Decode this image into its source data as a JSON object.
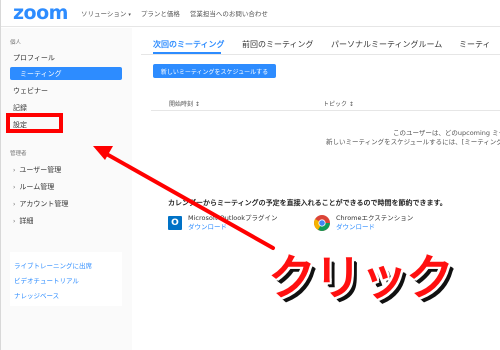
{
  "header": {
    "logo": "zoom",
    "nav": [
      {
        "label": "ソリューション",
        "chevron": "▾"
      },
      {
        "label": "プランと価格",
        "chevron": ""
      },
      {
        "label": "営業担当へのお問い合わせ",
        "chevron": ""
      }
    ]
  },
  "sidebar": {
    "personal_heading": "個人",
    "items": [
      {
        "label": "プロフィール"
      },
      {
        "label": "ミーティング"
      },
      {
        "label": "ウェビナー"
      },
      {
        "label": "記録"
      },
      {
        "label": "設定"
      }
    ],
    "admin_heading": "管理者",
    "admin_items": [
      {
        "caret": "›",
        "label": "ユーザー管理"
      },
      {
        "caret": "›",
        "label": "ルーム管理"
      },
      {
        "caret": "›",
        "label": "アカウント管理"
      },
      {
        "caret": "›",
        "label": "詳細"
      }
    ],
    "links": [
      {
        "label": "ライブトレーニングに出席"
      },
      {
        "label": "ビデオチュートリアル"
      },
      {
        "label": "ナレッジベース"
      }
    ]
  },
  "main": {
    "tabs": [
      {
        "label": "次回のミーティング"
      },
      {
        "label": "前回のミーティング"
      },
      {
        "label": "パーソナルミーティングルーム"
      },
      {
        "label": "ミーティ"
      }
    ],
    "schedule_button": "新しいミーティングをスケジュールする",
    "columns": [
      {
        "label": "開始時刻 ↕"
      },
      {
        "label": "トピック ↕"
      }
    ],
    "empty_lines": [
      "このユーザーは、どのupcoming ミーティ",
      "新しいミーティングをスケジュールするには、[ミーティング"
    ],
    "calendar_note": "カレンダーからミーティングの予定を直接入れることができるので時間を節約できます。",
    "plugins": [
      {
        "icon": "outlook-icon",
        "name": "Microsoft Outlookプラグイン",
        "download": "ダウンロード"
      },
      {
        "icon": "chrome-icon",
        "name": "Chromeエクステンション",
        "download": "ダウンロード"
      }
    ]
  },
  "annotation": {
    "label": "クリック",
    "color": "#ff1010",
    "arrow_target": "設定"
  },
  "colors": {
    "accent": "#2d8cff",
    "highlight": "#ff0000"
  }
}
